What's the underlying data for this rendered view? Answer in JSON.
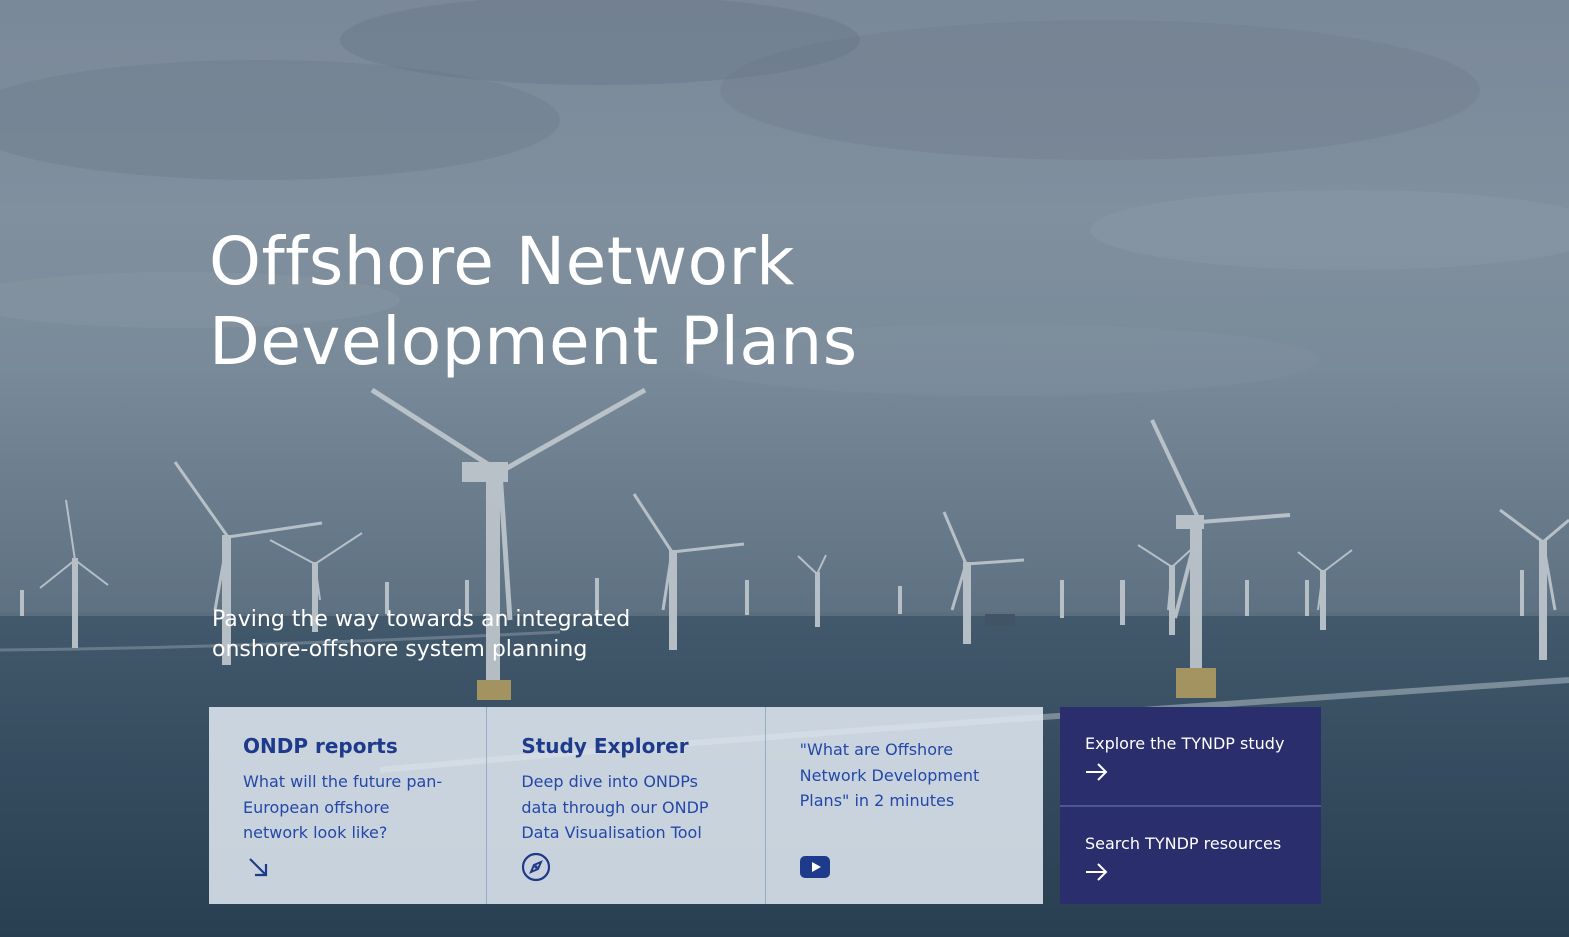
{
  "hero": {
    "title_line1": "Offshore Network",
    "title_line2": "Development Plans",
    "subtitle_line1": "Paving the way towards an integrated",
    "subtitle_line2": "onshore-offshore system planning"
  },
  "cards": [
    {
      "title": "ONDP reports",
      "text": "What will the future pan-European offshore network look like?",
      "icon": "arrow-down-right-icon"
    },
    {
      "title": "Study Explorer",
      "text": "Deep dive into ONDPs data through our ONDP Data Visualisation Tool",
      "icon": "compass-icon"
    },
    {
      "title": "",
      "text": "\"What are Offshore Network Development Plans\" in 2 minutes",
      "icon": "youtube-play-icon"
    }
  ],
  "actions": [
    {
      "label": "Explore the TYNDP study",
      "icon": "arrow-right-icon"
    },
    {
      "label": "Search TYNDP resources",
      "icon": "arrow-right-icon"
    }
  ],
  "colors": {
    "card_title": "#1e3a8a",
    "card_text": "#2448a8",
    "action_bg": "#2a2e6c",
    "card_bg": "#e2eaf2"
  }
}
